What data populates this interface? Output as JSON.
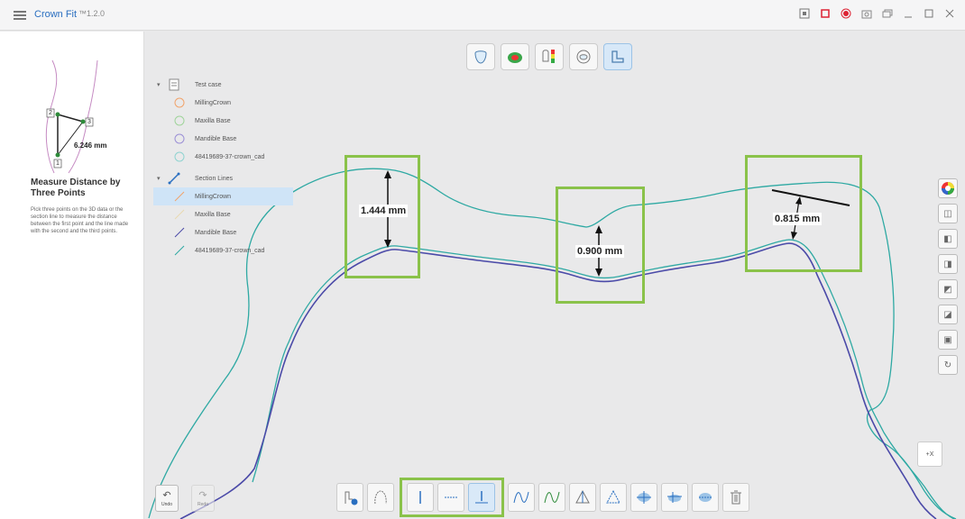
{
  "app": {
    "title": "Crown Fit",
    "version": "™1.2.0"
  },
  "left_panel": {
    "preview_value": "6.246 mm",
    "preview_points": [
      "1",
      "2",
      "3"
    ],
    "title": "Measure Distance by Three Points",
    "description": "Pick three points on the 3D data or the section line to measure the distance between the first point and the line made with the second and the third points."
  },
  "tree": {
    "group1": "Test case",
    "items1": [
      "MillingCrown",
      "Maxilla Base",
      "Mandible Base",
      "48419689-37-crown_cad"
    ],
    "group2": "Section Lines",
    "items2": [
      "MillingCrown",
      "Maxilla Base",
      "Mandible Base",
      "48419689-37-crown_cad"
    ]
  },
  "measurements": [
    "1.444 mm",
    "0.900 mm",
    "0.815 mm"
  ],
  "toolbar": {
    "undo_label": "Undo",
    "redo_label": "Redo"
  },
  "axis_label": "+X",
  "colors": {
    "accent": "#2a6fc0",
    "highlight": "#8ac24a",
    "teal": "#2ea9a3",
    "purple": "#4b4aa8"
  }
}
